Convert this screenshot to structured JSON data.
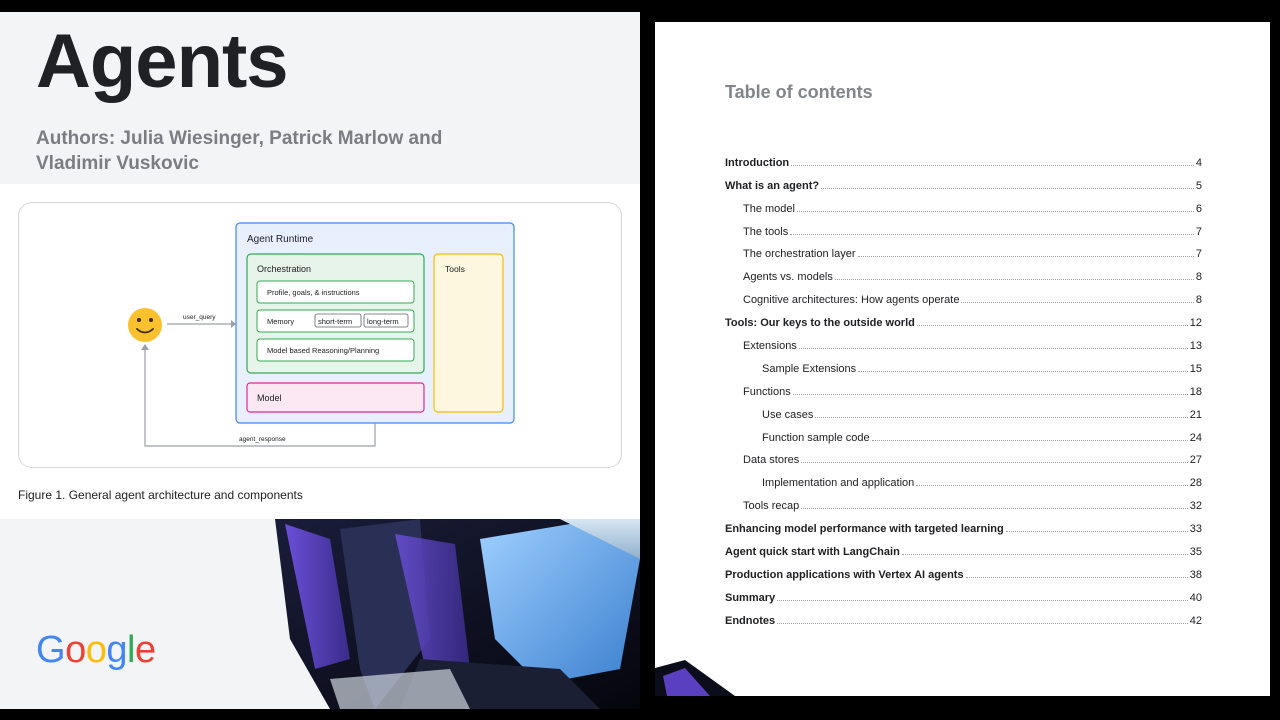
{
  "cover": {
    "title": "Agents",
    "authors": "Authors: Julia Wiesinger, Patrick Marlow and Vladimir Vuskovic",
    "figure_caption": "Figure 1. General agent architecture and components",
    "logo_letters": [
      {
        "char": "G",
        "color": "#4285F4"
      },
      {
        "char": "o",
        "color": "#EA4335"
      },
      {
        "char": "o",
        "color": "#FBBC05"
      },
      {
        "char": "g",
        "color": "#4285F4"
      },
      {
        "char": "l",
        "color": "#34A853"
      },
      {
        "char": "e",
        "color": "#EA4335"
      }
    ]
  },
  "diagram": {
    "runtime_label": "Agent Runtime",
    "orchestration_label": "Orchestration",
    "profile_label": "Profile, goals, & instructions",
    "memory_label": "Memory",
    "short_term_label": "short-term",
    "long_term_label": "long-term",
    "reasoning_label": "Model based Reasoning/Planning",
    "model_label": "Model",
    "tools_label": "Tools",
    "user_query_label": "user_query",
    "agent_response_label": "agent_response",
    "colors": {
      "runtime_fill": "#e8f0fe",
      "runtime_stroke": "#4285f4",
      "orch_fill": "#e6f4ea",
      "orch_stroke": "#34a853",
      "model_fill": "#fce8f3",
      "model_stroke": "#e52592",
      "tools_fill": "#fef7e0",
      "tools_stroke": "#fbbc04"
    }
  },
  "toc": {
    "heading": "Table of contents",
    "entries": [
      {
        "text": "Introduction",
        "page": "4",
        "level": 0
      },
      {
        "text": "What is an agent?",
        "page": "5",
        "level": 0
      },
      {
        "text": "The model",
        "page": "6",
        "level": 1
      },
      {
        "text": "The tools",
        "page": "7",
        "level": 1
      },
      {
        "text": "The orchestration layer",
        "page": "7",
        "level": 1
      },
      {
        "text": "Agents vs. models",
        "page": "8",
        "level": 1
      },
      {
        "text": "Cognitive architectures: How agents operate",
        "page": "8",
        "level": 1
      },
      {
        "text": "Tools: Our keys to the outside world",
        "page": "12",
        "level": 0
      },
      {
        "text": "Extensions",
        "page": "13",
        "level": 1
      },
      {
        "text": "Sample Extensions",
        "page": "15",
        "level": 2
      },
      {
        "text": "Functions",
        "page": "18",
        "level": 1
      },
      {
        "text": "Use cases",
        "page": "21",
        "level": 2
      },
      {
        "text": "Function sample code",
        "page": "24",
        "level": 2
      },
      {
        "text": "Data stores",
        "page": "27",
        "level": 1
      },
      {
        "text": "Implementation and application",
        "page": "28",
        "level": 2
      },
      {
        "text": "Tools recap",
        "page": "32",
        "level": 1
      },
      {
        "text": "Enhancing model performance with targeted learning",
        "page": "33",
        "level": 0
      },
      {
        "text": "Agent quick start with LangChain",
        "page": "35",
        "level": 0
      },
      {
        "text": "Production applications with Vertex AI agents",
        "page": "38",
        "level": 0
      },
      {
        "text": "Summary",
        "page": "40",
        "level": 0
      },
      {
        "text": "Endnotes",
        "page": "42",
        "level": 0
      }
    ]
  }
}
